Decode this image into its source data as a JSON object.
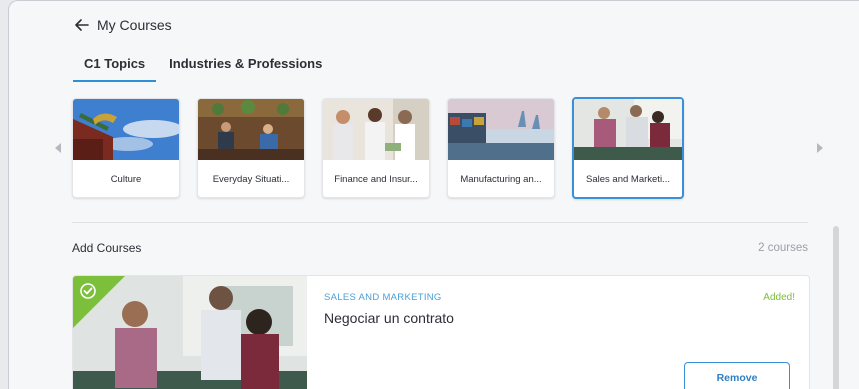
{
  "header": {
    "back_label": "My Courses"
  },
  "tabs": [
    {
      "label": "C1 Topics",
      "active": true
    },
    {
      "label": "Industries & Professions",
      "active": false
    }
  ],
  "topics": [
    {
      "label": "Culture",
      "selected": false
    },
    {
      "label": "Everyday Situati...",
      "selected": false
    },
    {
      "label": "Finance and Insur...",
      "selected": false
    },
    {
      "label": "Manufacturing an...",
      "selected": false
    },
    {
      "label": "Sales and Marketi...",
      "selected": true
    }
  ],
  "add_courses": {
    "title": "Add Courses",
    "count": "2 courses",
    "items": [
      {
        "category": "SALES AND MARKETING",
        "title": "Negociar un contrato",
        "status": "Added!",
        "button": "Remove"
      }
    ]
  },
  "colors": {
    "accent": "#3a8fd9",
    "added_green": "#7cbf3a",
    "category_blue": "#4aa0d8"
  }
}
